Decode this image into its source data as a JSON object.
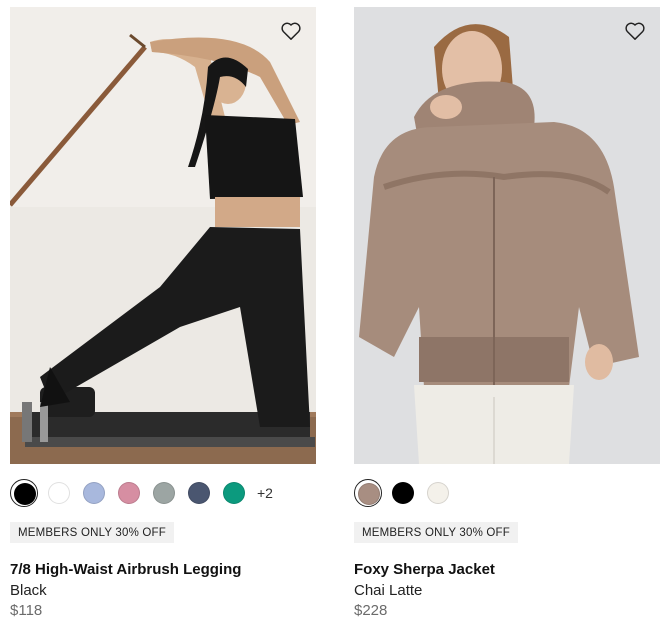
{
  "products": [
    {
      "name": "7/8 High-Waist Airbrush Legging",
      "color_name": "Black",
      "price": "$118",
      "badge": "MEMBERS ONLY 30% OFF",
      "more_colors": "+2",
      "swatches": [
        "#000000",
        "#ffffff",
        "#a8b8dd",
        "#d68ea2",
        "#9ca5a3",
        "#4a5670",
        "#0c9a7e"
      ],
      "selected_swatch": 0,
      "image_icon": "woman-pilates-photo"
    },
    {
      "name": "Foxy Sherpa Jacket",
      "color_name": "Chai Latte",
      "price": "$228",
      "badge": "MEMBERS ONLY 30% OFF",
      "swatches": [
        "#a88e82",
        "#000000",
        "#f4f1ea"
      ],
      "selected_swatch": 0,
      "image_icon": "woman-sherpa-jacket-photo"
    }
  ],
  "colors": {
    "price_gray": "#6b6b6b",
    "badge_bg": "#f1f1f1"
  }
}
